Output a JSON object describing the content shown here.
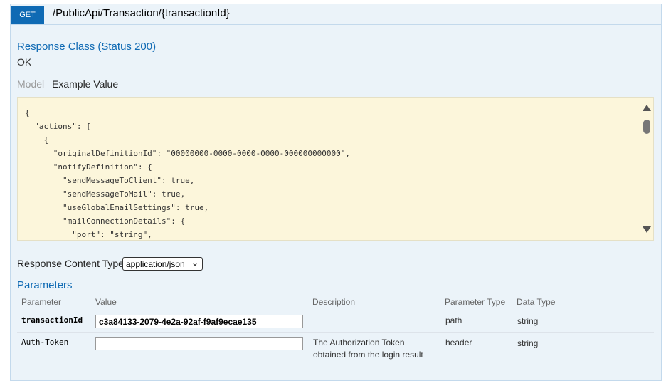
{
  "operation": {
    "method": "GET",
    "path": "/PublicApi/Transaction/{transactionId}"
  },
  "response_class": {
    "title": "Response Class (Status 200)",
    "status_text": "OK",
    "tabs": {
      "model": "Model",
      "example": "Example Value"
    },
    "example_lines": [
      "{",
      "  \"actions\": [",
      "    {",
      "      \"originalDefinitionId\": \"00000000-0000-0000-0000-000000000000\",",
      "      \"notifyDefinition\": {",
      "        \"sendMessageToClient\": true,",
      "        \"sendMessageToMail\": true,",
      "        \"useGlobalEmailSettings\": true,",
      "        \"mailConnectionDetails\": {",
      "          \"port\": \"string\","
    ]
  },
  "response_content_type": {
    "label": "Response Content Type",
    "selected": "application/json"
  },
  "parameters": {
    "title": "Parameters",
    "headers": {
      "parameter": "Parameter",
      "value": "Value",
      "description": "Description",
      "parameter_type": "Parameter Type",
      "data_type": "Data Type"
    },
    "rows": [
      {
        "name": "transactionId",
        "value": "c3a84133-2079-4e2a-92af-f9af9ecae135",
        "description_line1": "",
        "description_line2": "",
        "parameter_type": "path",
        "data_type": "string"
      },
      {
        "name": "Auth-Token",
        "value": "",
        "description_line1": "The Authorization Token",
        "description_line2": "obtained from the login result",
        "parameter_type": "header",
        "data_type": "string"
      }
    ]
  },
  "colors": {
    "method_bg": "#0f6ab4",
    "section_title": "#0f6ab4",
    "code_bg": "#fcf6db",
    "panel_bg": "#ebf3f9"
  }
}
